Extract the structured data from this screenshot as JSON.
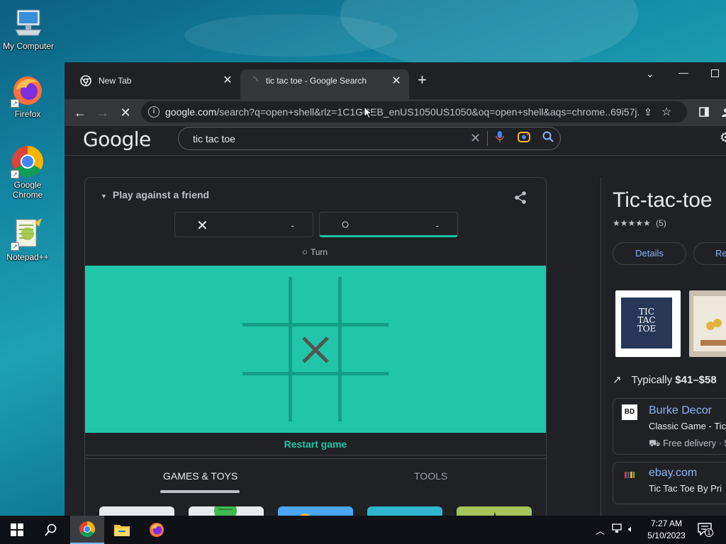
{
  "desktop": {
    "icons": [
      {
        "label": "My Computer"
      },
      {
        "label": "Firefox"
      },
      {
        "label": "Google Chrome"
      },
      {
        "label": "Notepad++"
      }
    ]
  },
  "browser": {
    "tabs": [
      {
        "title": "New Tab"
      },
      {
        "title": "tic tac toe - Google Search"
      }
    ],
    "url_host": "google.com",
    "url_path": "/search?q=open+shell&rlz=1C1GCEB_enUS1050US1050&oq=open+shell&aqs=chrome..69i57j..."
  },
  "google": {
    "logo": "Google",
    "query": "tic tac toe"
  },
  "game": {
    "mode_label": "Play against a friend",
    "players": [
      {
        "mark": "✕",
        "score": "-"
      },
      {
        "mark": "○",
        "score": "-"
      }
    ],
    "turn_mark": "○",
    "turn_label": "Turn",
    "board": [
      "",
      "",
      "",
      "",
      "X",
      "",
      "",
      "",
      ""
    ],
    "restart_label": "Restart game",
    "category_tabs": [
      "GAMES & TOYS",
      "TOOLS"
    ],
    "active_category": "GAMES & TOYS"
  },
  "knowledge_panel": {
    "title": "Tic-tac-toe",
    "rating_stars": "★★★★★",
    "rating_value": 4,
    "rating_count": "(5)",
    "buttons": [
      "Details",
      "Re"
    ],
    "product_image_text": "TIC\nTAC\nTOE",
    "price_prefix": "Typically ",
    "price_range": "$41–$58",
    "sellers": [
      {
        "logo": "BD",
        "name": "Burke Decor",
        "product": "Classic Game - Tic",
        "delivery": "Free delivery · $"
      },
      {
        "logo": "ebay",
        "name": "ebay.com",
        "product": "Tic Tac Toe By Pri",
        "delivery": ""
      }
    ]
  },
  "taskbar": {
    "time": "7:27 AM",
    "date": "5/10/2023",
    "notification_count": "1"
  },
  "colors": {
    "board": "#21c5a7",
    "grid_line": "#129e88",
    "page_bg": "#202124",
    "link": "#8ab4f8"
  }
}
